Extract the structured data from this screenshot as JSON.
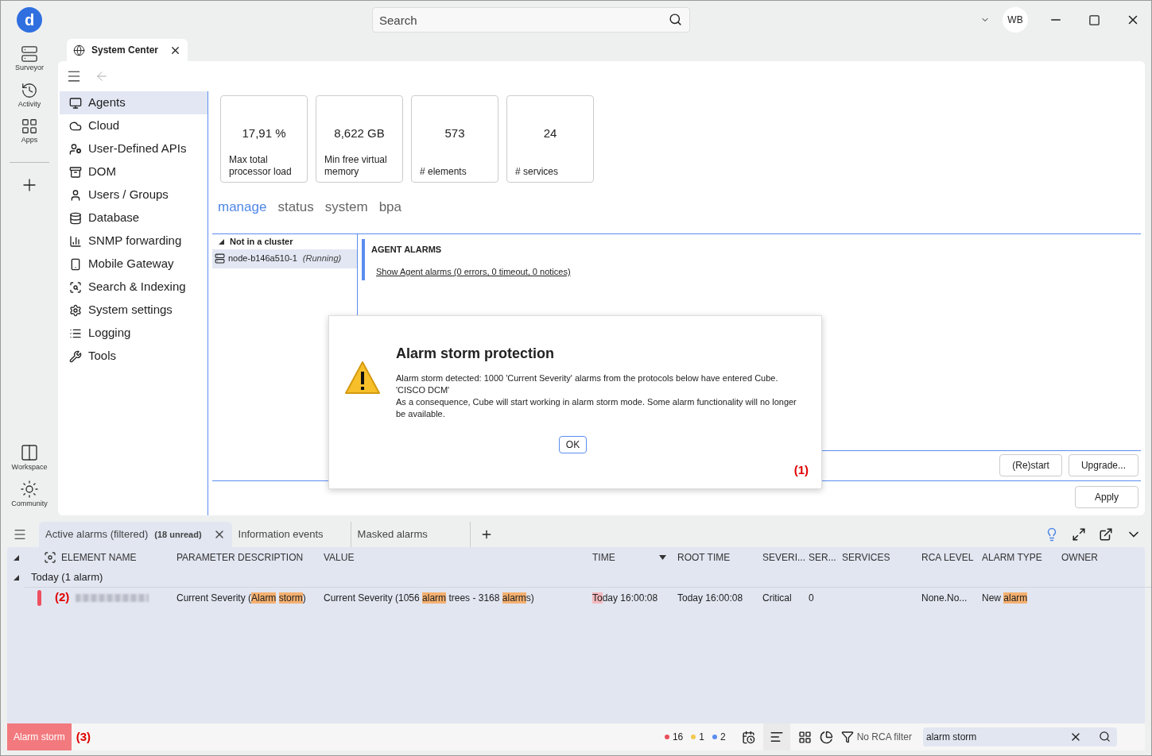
{
  "app": {
    "logo": "d"
  },
  "search": {
    "placeholder": "Search"
  },
  "user": {
    "initials": "WB"
  },
  "rail": {
    "top": [
      {
        "label": "Surveyor"
      },
      {
        "label": "Activity"
      },
      {
        "label": "Apps"
      }
    ],
    "bottom": [
      {
        "label": "Workspace"
      },
      {
        "label": "Community"
      }
    ]
  },
  "doc_tab": {
    "title": "System Center"
  },
  "nav": [
    {
      "label": "Agents",
      "selected": true
    },
    {
      "label": "Cloud",
      "selected": false
    },
    {
      "label": "User-Defined APIs",
      "selected": false
    },
    {
      "label": "DOM",
      "selected": false
    },
    {
      "label": "Users / Groups",
      "selected": false
    },
    {
      "label": "Database",
      "selected": false
    },
    {
      "label": "SNMP forwarding",
      "selected": false
    },
    {
      "label": "Mobile Gateway",
      "selected": false
    },
    {
      "label": "Search & Indexing",
      "selected": false
    },
    {
      "label": "System settings",
      "selected": false
    },
    {
      "label": "Logging",
      "selected": false
    },
    {
      "label": "Tools",
      "selected": false
    }
  ],
  "stats": [
    {
      "value": "17,91 %",
      "label": "Max total processor load"
    },
    {
      "value": "8,622 GB",
      "label": "Min free virtual memory"
    },
    {
      "value": "573",
      "label": "# elements"
    },
    {
      "value": "24",
      "label": "# services"
    }
  ],
  "subtabs": [
    {
      "label": "manage",
      "selected": true
    },
    {
      "label": "status",
      "selected": false
    },
    {
      "label": "system",
      "selected": false
    },
    {
      "label": "bpa",
      "selected": false
    }
  ],
  "tree": {
    "group": "Not in a cluster",
    "expanded": true,
    "nodes": [
      {
        "name": "node-b146a510-1",
        "state": "(Running)",
        "selected": true
      }
    ]
  },
  "agent_alarms": {
    "heading": "AGENT ALARMS",
    "link": "Show Agent alarms (0 errors, 0 timeout, 0 notices)"
  },
  "actions": [
    "(Re)start",
    "Upgrade..."
  ],
  "apply": "Apply",
  "dialog": {
    "title": "Alarm storm protection",
    "lines": [
      "Alarm storm detected: 1000 'Current Severity' alarms from the protocols below have entered Cube.",
      "'CISCO DCM'",
      "As a consequence, Cube will start working in alarm storm mode. Some alarm functionality will no longer be available."
    ],
    "ok": "OK",
    "marker": "(1)"
  },
  "alarm_tabs": [
    {
      "label": "Active alarms (filtered)",
      "badge": "(18 unread)",
      "selected": true,
      "closable": true
    },
    {
      "label": "Information events",
      "selected": false,
      "closable": false
    },
    {
      "label": "Masked alarms",
      "selected": false,
      "closable": false
    }
  ],
  "columns": [
    {
      "label": "ELEMENT NAME"
    },
    {
      "label": "PARAMETER DESCRIPTION"
    },
    {
      "label": "VALUE"
    },
    {
      "label": "TIME",
      "sorted": true
    },
    {
      "label": "ROOT TIME"
    },
    {
      "label": "SEVERI..."
    },
    {
      "label": "SER..."
    },
    {
      "label": "SERVICES"
    },
    {
      "label": "RCA LEVEL"
    },
    {
      "label": "ALARM TYPE"
    },
    {
      "label": "OWNER"
    }
  ],
  "groups": [
    {
      "label": "Today (1 alarm)",
      "expanded": true,
      "rows": [
        {
          "color": "#ef5060",
          "marker": "(2)",
          "cells": [
            {
              "kind": "blurred"
            },
            {
              "kind": "text",
              "segments": [
                {
                  "text": "Current Severity (",
                  "kind": "plain"
                },
                {
                  "text": "Alarm storm",
                  "kind": "match"
                },
                {
                  "text": ")",
                  "kind": "plain"
                }
              ]
            },
            {
              "kind": "text",
              "segments": [
                {
                  "text": "Current Severity (1056 ",
                  "kind": "plain"
                },
                {
                  "text": "alarm",
                  "kind": "match"
                },
                {
                  "text": " trees - 3168 ",
                  "kind": "plain"
                },
                {
                  "text": "alarm",
                  "kind": "match"
                },
                {
                  "text": "s)",
                  "kind": "plain"
                }
              ]
            },
            {
              "kind": "text",
              "segments": [
                {
                  "text": "To",
                  "kind": "severity"
                },
                {
                  "text": "day 16:00:08",
                  "kind": "plain"
                }
              ]
            },
            {
              "kind": "text",
              "segments": [
                {
                  "text": "Today 16:00:08",
                  "kind": "plain"
                }
              ]
            },
            {
              "kind": "text",
              "segments": [
                {
                  "text": "Critical",
                  "kind": "plain"
                }
              ]
            },
            {
              "kind": "text",
              "segments": [
                {
                  "text": "0",
                  "kind": "plain"
                }
              ]
            },
            {
              "kind": "empty"
            },
            {
              "kind": "text",
              "segments": [
                {
                  "text": "None.No...",
                  "kind": "plain"
                }
              ]
            },
            {
              "kind": "text",
              "segments": [
                {
                  "text": "New ",
                  "kind": "plain"
                },
                {
                  "text": "alarm",
                  "kind": "match"
                }
              ]
            },
            {
              "kind": "empty"
            }
          ]
        }
      ]
    }
  ],
  "status": {
    "label": "Alarm storm",
    "marker": "(3)",
    "counts": [
      {
        "value": "16",
        "color": "#e8505b"
      },
      {
        "value": "1",
        "color": "#f2c94c"
      },
      {
        "value": "2",
        "color": "#5b8def"
      }
    ],
    "rca": "No RCA filter",
    "filter": {
      "value": "alarm storm"
    }
  }
}
